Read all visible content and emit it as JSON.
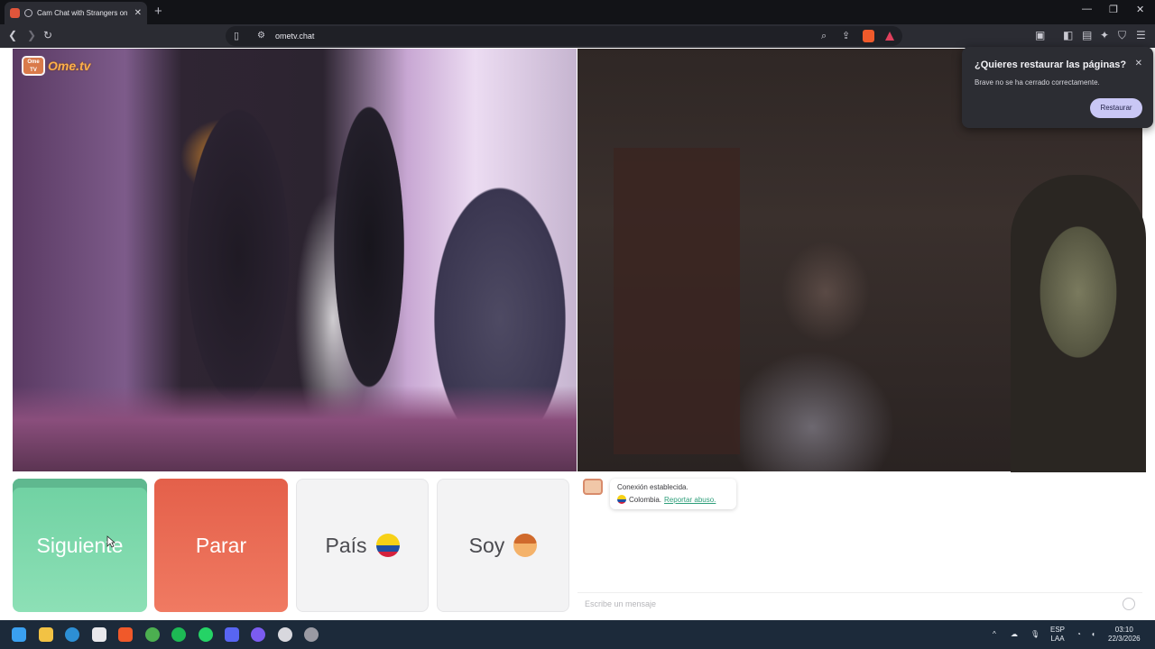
{
  "browser": {
    "tab_title": "Cam Chat with Strangers on Ome",
    "new_tab": "+",
    "url": "ometv.chat",
    "window_controls": [
      "—",
      "❐",
      "✕"
    ]
  },
  "site": {
    "logo_text": "Ome.tv",
    "logo_badge": "Ome TV"
  },
  "popup": {
    "title": "¿Quieres restaurar las páginas?",
    "message": "Brave no se ha cerrado correctamente.",
    "button": "Restaurar",
    "close": "✕"
  },
  "controls": {
    "next": "Siguiente",
    "stop": "Parar",
    "country": "País",
    "soy": "Soy"
  },
  "chat": {
    "message_line1": "Conexión establecida.",
    "country": "Colombia.",
    "report": "Reportar abuso.",
    "input_placeholder": "Escribe un mensaje"
  },
  "taskbar": {
    "lang_top": "ESP",
    "lang_bottom": "LAA",
    "time": "03:10",
    "date": "22/3/2026",
    "chevron": "^"
  },
  "colors": {
    "next": "#76d6a8",
    "stop": "#e9654e",
    "accent": "#c9c7f5"
  }
}
